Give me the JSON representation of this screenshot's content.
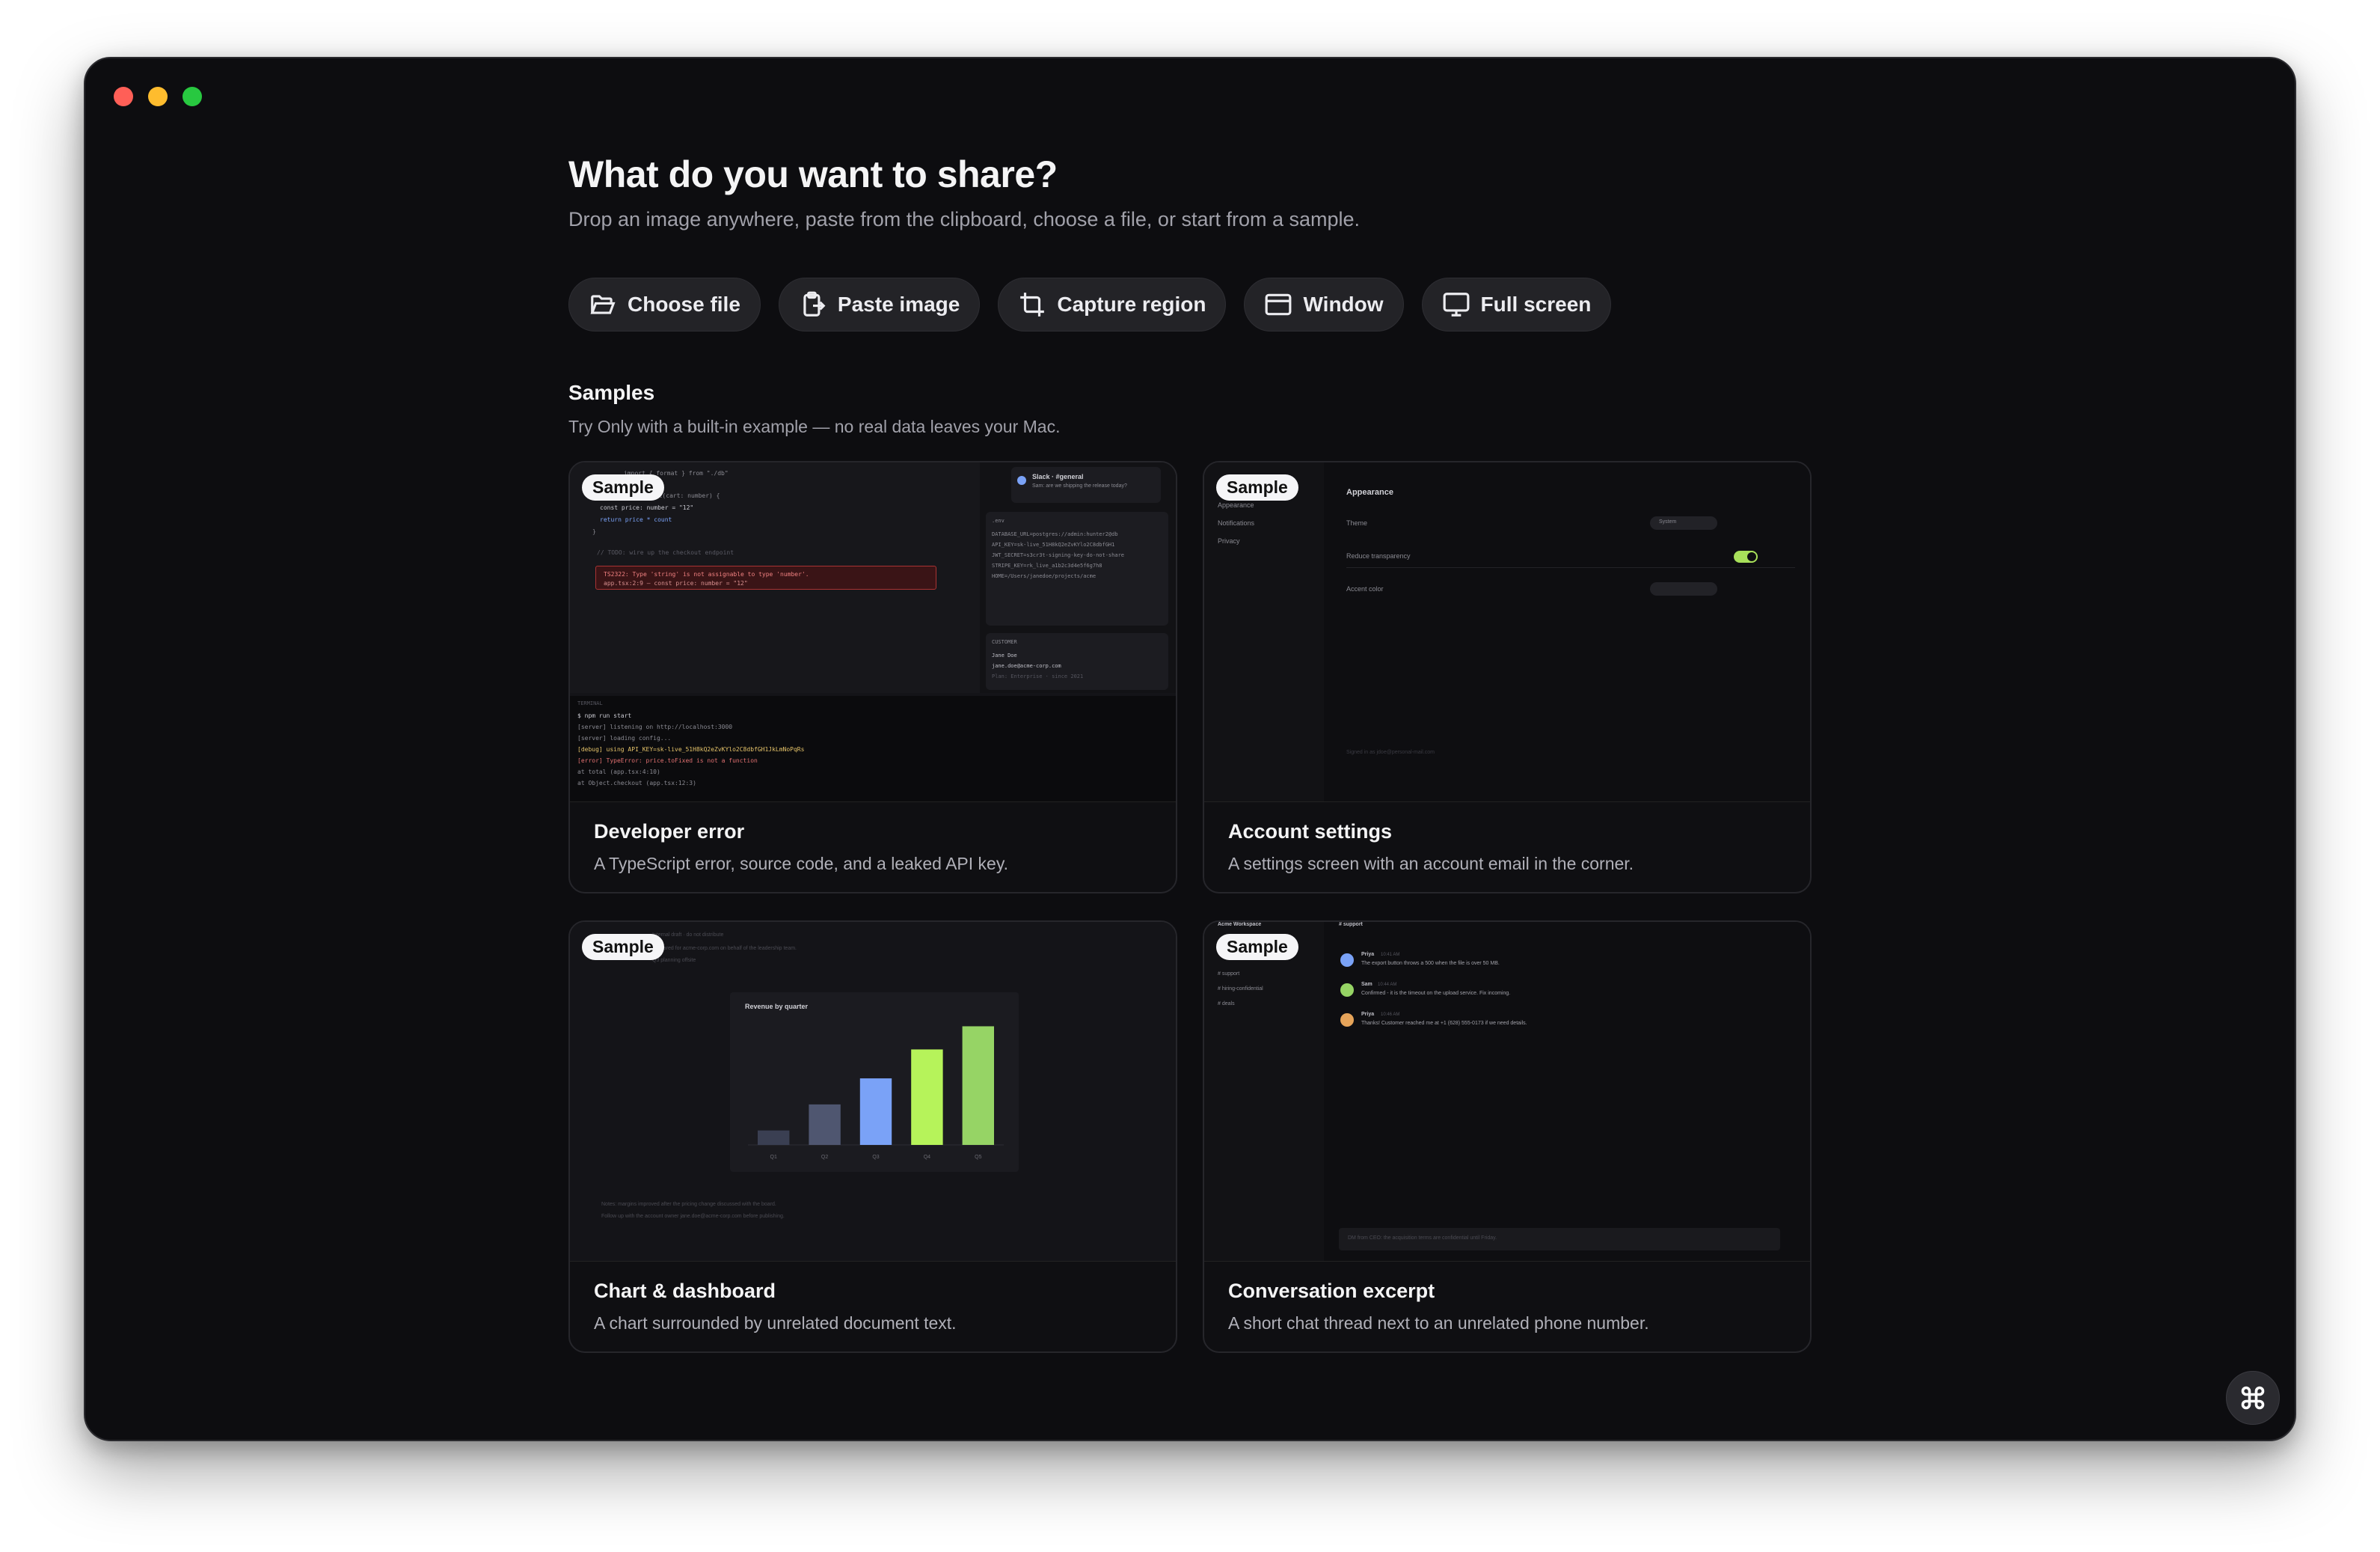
{
  "header": {
    "title": "What do you want to share?",
    "subtitle": "Drop an image anywhere, paste from the clipboard, choose a file, or start from a sample."
  },
  "actions": {
    "choose_file": "Choose file",
    "paste_image": "Paste image",
    "capture_region": "Capture region",
    "window": "Window",
    "full_screen": "Full screen"
  },
  "samples": {
    "heading": "Samples",
    "subtitle": "Try Only with a built-in example — no real data leaves your Mac.",
    "badge": "Sample",
    "cards": [
      {
        "title": "Developer error",
        "desc": "A TypeScript error, source code, and a leaked API key."
      },
      {
        "title": "Account settings",
        "desc": "A settings screen with an account email in the corner."
      },
      {
        "title": "Chart & dashboard",
        "desc": "A chart surrounded by unrelated document text."
      },
      {
        "title": "Conversation excerpt",
        "desc": "A short chat thread next to an unrelated phone number."
      }
    ]
  },
  "previews": {
    "dev": {
      "code1": "import { format } from \"./db\"",
      "code2": "function total(cart: number) {",
      "code3": "  const price: number = \"12\"",
      "code4": "  return price * count",
      "code5": "}",
      "code6": "// TODO: wire up the checkout endpoint",
      "err1": "TS2322: Type 'string' is not assignable to type 'number'.",
      "err2": "app.tsx:2:9 — const price: number = \"12\"",
      "slack_title": "Slack · #general",
      "slack_msg": "Sam: are we shipping the release today?",
      "env_label": ".env",
      "env1": "DATABASE_URL=postgres://admin:hunter2@db",
      "env2": "API_KEY=sk-live_51H8kQ2eZvKYlo2C8dbfGH1",
      "env3": "JWT_SECRET=s3cr3t-signing-key-do-not-share",
      "env4": "STRIPE_KEY=rk_live_a1b2c3d4e5f6g7h8",
      "env5": "HOME=/Users/janedoe/projects/acme",
      "cust_label": "CUSTOMER",
      "cust_name": "Jane Doe",
      "cust_email": "jane.doe@acme-corp.com",
      "cust_plan": "Plan: Enterprise · since 2021",
      "term_label": "TERMINAL",
      "t1": "$ npm run start",
      "t2": "[server] listening on http://localhost:3000",
      "t3": "[server] loading config...",
      "t4": "[debug] using API_KEY=sk-live_51H8kQ2eZvKYlo2C8dbfGH1JkLmNoPqRs",
      "t5": "[error] TypeError: price.toFixed is not a function",
      "t6": "  at total (app.tsx:4:10)",
      "t7": "  at Object.checkout (app.tsx:12:3)"
    },
    "settings": {
      "nav1": "Appearance",
      "nav2": "Notifications",
      "nav3": "Privacy",
      "heading": "Appearance",
      "theme": "Theme",
      "theme_value": "System",
      "transparency": "Reduce transparency",
      "accent": "Accent color",
      "footer": "Signed in as jdoe@personal-mail.com"
    },
    "chart": {
      "doc1": "Internal draft · do not distribute",
      "doc2": "Prepared for acme-corp.com on behalf of the leadership team.",
      "doc3": "Q3 planning offsite",
      "note1": "Notes: margins improved after the pricing change discussed with the board.",
      "note2": "Follow up with the account owner jane.doe@acme-corp.com before publishing."
    },
    "chat": {
      "workspace": "Acme Workspace",
      "channel": "# support",
      "ch1": "# support",
      "ch2": "# hiring-confidential",
      "ch3": "# deals",
      "m1_name": "Priya",
      "m1_time": "10:41 AM",
      "m1_text": "The export button throws a 500 when the file is over 50 MB.",
      "m2_name": "Sam",
      "m2_time": "10:44 AM",
      "m2_text": "Confirmed - it is the timeout on the upload service. Fix incoming.",
      "m3_name": "Priya",
      "m3_time": "10:46 AM",
      "m3_text": "Thanks! Customer reached me at +1 (628) 555-0173 if we need details.",
      "input": "DM from CEO: the acquisition terms are confidential until Friday."
    }
  },
  "chart_data": {
    "type": "bar",
    "title": "Revenue by quarter",
    "categories": [
      "Q1",
      "Q2",
      "Q3",
      "Q4",
      "Q5"
    ],
    "values": [
      10,
      28,
      46,
      66,
      82
    ],
    "ylim": [
      0,
      90
    ],
    "colors": [
      "#3a3f52",
      "#4f5670",
      "#7aa2f7",
      "#b6f35a",
      "#96d465"
    ]
  },
  "colors": {
    "window_bg": "#0d0d10",
    "button_bg": "#232327",
    "accent_green": "#a8e05a"
  }
}
